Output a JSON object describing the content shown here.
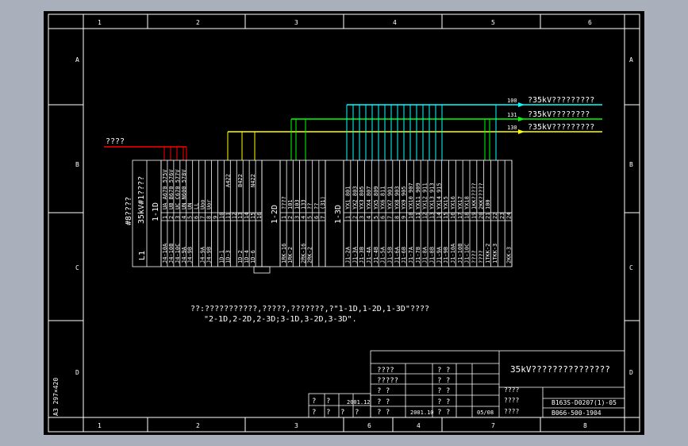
{
  "colors": {
    "bg": "#aab0bb",
    "sheet": "#000000",
    "frame": "#ffffff",
    "red": "#ff0000",
    "yellow": "#ffff00",
    "green": "#00ff00",
    "cyan": "#00ffff"
  },
  "frame": {
    "columns_top": [
      "1",
      "2",
      "3",
      "4",
      "5",
      "6"
    ],
    "columns_bottom": [
      "1",
      "2",
      "3",
      "6",
      "4",
      "7",
      "8"
    ],
    "rows": [
      "A",
      "B",
      "C",
      "D"
    ],
    "sheet_size": "A3 297×420"
  },
  "buses": [
    {
      "num": "100",
      "label": "?35kV?????????"
    },
    {
      "num": "131",
      "label": "?35kV????????"
    },
    {
      "num": "130",
      "label": "?35kV?????????"
    }
  ],
  "red_label": "????",
  "panel": {
    "row_label": "#8????",
    "title": "35kV#1????",
    "code": "L1",
    "sec1_name": "1-1D",
    "sec1_top": [
      "UA A670 575V",
      "UB B670 576V",
      "UC C670 577V",
      "UN N600 578V",
      "UN",
      "LL",
      "Uoo",
      "Uor"
    ],
    "sec1_mid": [
      "A422",
      "",
      "B422",
      "",
      "N422"
    ],
    "sec1_nums": [
      "1",
      "2",
      "3",
      "4",
      "5",
      "6",
      "7",
      "8",
      "9",
      "10",
      "11",
      "12",
      "13",
      "14",
      "15",
      "16"
    ],
    "sec1_bot": [
      "J4-10A",
      "J4-10B",
      "J4-10C",
      "J4-9A",
      "J4-9B",
      "",
      "J4-9A",
      "J4-9B",
      "",
      "1D-1",
      "1D-3",
      "",
      "1D-2",
      "1D-4",
      "1D-6",
      ""
    ],
    "sec2_name": "1-2D",
    "sec2_top": [
      "????",
      "101",
      "103",
      "133",
      "??",
      "??",
      "(31)"
    ],
    "sec2_nums": [
      "1",
      "2",
      "3",
      "4",
      "5",
      "6",
      "7"
    ],
    "sec2_bot": [
      "1RK-16",
      "1RK-2",
      "",
      "2RK-16",
      "2RK-2",
      "",
      ""
    ],
    "sec3_name": "1-3D",
    "sec3_top": [
      "YX1 801",
      "YX2 803",
      "YX3 805",
      "YX4 807",
      "YX5 809",
      "YX6 811",
      "YX7 901",
      "YX8 903",
      "YX9 905",
      "YX10 907",
      "YX11 909",
      "YX12 911",
      "YX13 913",
      "YX14 915",
      "YX15",
      "YX16",
      "YX17",
      "YX18",
      "1KK?????",
      "2KK?????",
      "100"
    ],
    "sec3_nums": [
      "1",
      "2",
      "3",
      "4",
      "5",
      "6",
      "7",
      "8",
      "9",
      "10",
      "11",
      "12",
      "13",
      "14",
      "15",
      "16",
      "17",
      "18",
      "19",
      "20",
      "21",
      "22",
      "23",
      "24"
    ],
    "sec3_bot": [
      "J1-2A",
      "J1-3A",
      "J1-3B",
      "J1-4A",
      "J1-4B",
      "J1-5A",
      "J1-5B",
      "J1-6A",
      "J1-6B",
      "J1-7A",
      "J1-7B",
      "J1-8A",
      "J1-8B",
      "J1-9A",
      "J1-9B",
      "J1-10A",
      "J1-10B",
      "J1-10C",
      "????",
      "????",
      "1TKK-2",
      "1TKK-3",
      "",
      "2KK-3"
    ]
  },
  "notes": {
    "line1": "??:???????????,?????,???????,?\"1-1D,1-2D,1-3D\"????",
    "line2": "\"2-1D,2-2D,2-3D;3-1D,3-2D,3-3D\"."
  },
  "title_block": {
    "drawing_title": "35kV???????????????",
    "left_rows": [
      "????",
      "?????",
      "?  ?",
      "?  ?",
      "?  ?"
    ],
    "mid_rows": [
      "?  ?",
      "?  ?",
      "?  ?",
      "?  ?",
      "?  ?"
    ],
    "date1": "2001.12",
    "date2": "2001.10",
    "sheet_no": "05/08",
    "right_labels": [
      "????",
      "????",
      "????"
    ],
    "drawing_no": "B163S-D0207(1)-05",
    "drawing_no2": "B066-500-1904",
    "rev_cells": [
      "?",
      "?",
      "?",
      "?",
      "?",
      "?"
    ]
  }
}
